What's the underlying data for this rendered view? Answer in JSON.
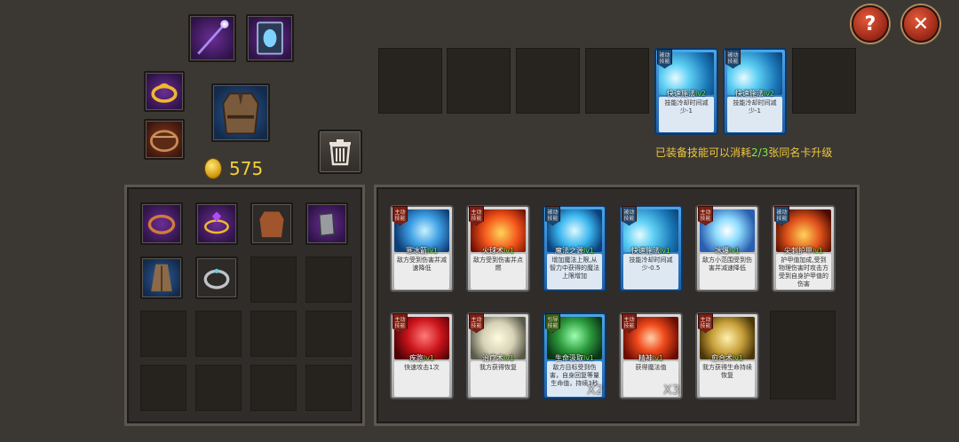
{
  "gold": {
    "amount": "575"
  },
  "buttons": {
    "help": "?",
    "close": "✕"
  },
  "upgrade_note": {
    "prefix": "已装备技能可以消耗",
    "ratio": "2/3",
    "suffix": "张同名卡升级"
  },
  "equipped_skills": [
    {
      "tag": "被动技能",
      "name": "快速施法",
      "level": "lv2",
      "desc": "技能冷却时间减少-1",
      "art": "wave"
    },
    {
      "tag": "被动技能",
      "name": "快速施法",
      "level": "lv2",
      "desc": "技能冷却时间减少-1",
      "art": "wave"
    }
  ],
  "skill_cards": [
    {
      "tag": "主动技能",
      "name": "寒冰箭",
      "level": "lv1",
      "desc": "敌方受到伤害并减速降低",
      "art": "ice",
      "frame": "silver",
      "tagc": "red"
    },
    {
      "tag": "主动技能",
      "name": "火球术",
      "level": "lv1",
      "desc": "敌方受到伤害并点燃",
      "art": "fire",
      "frame": "silver",
      "tagc": "red"
    },
    {
      "tag": "被动技能",
      "name": "魔法之源",
      "level": "lv1",
      "desc": "增加魔法上限,从智力中获得的魔法上限增加",
      "art": "orb",
      "frame": "blue",
      "tagc": "blue"
    },
    {
      "tag": "被动技能",
      "name": "快速施法",
      "level": "lv1",
      "desc": "技能冷却时间减少-0.5",
      "art": "wave",
      "frame": "blue",
      "tagc": "blue"
    },
    {
      "tag": "主动技能",
      "name": "冰爆",
      "level": "lv1",
      "desc": "敌方小范围受到伤害并减速降低",
      "art": "burst",
      "frame": "silver",
      "tagc": "red"
    },
    {
      "tag": "被动技能",
      "name": "尖刺护甲",
      "level": "lv1",
      "desc": "护甲值加成,受到物理伤害时攻击方受到自身护甲值的伤害",
      "art": "spikes",
      "frame": "silver",
      "tagc": "blue"
    },
    {
      "tag": "主动技能",
      "name": "疾跑",
      "level": "lv1",
      "desc": "快速攻击1次",
      "art": "slash",
      "frame": "silver",
      "tagc": "red"
    },
    {
      "tag": "主动技能",
      "name": "治疗术",
      "level": "lv1",
      "desc": "我方获得恢复",
      "art": "hand",
      "frame": "silver",
      "tagc": "red"
    },
    {
      "tag": "引导技能",
      "name": "生命汲取",
      "level": "lv1",
      "desc": "敌方目标受到伤害，自身回复等量生命值，持续3秒",
      "art": "ghost",
      "frame": "blue",
      "tagc": "green",
      "count": "X2"
    },
    {
      "tag": "主动技能",
      "name": "精神",
      "level": "lv1",
      "desc": "获得魔法值",
      "art": "swirl",
      "frame": "silver",
      "tagc": "red",
      "count": "X3"
    },
    {
      "tag": "主动技能",
      "name": "愈合术",
      "level": "lv1",
      "desc": "我方获得生命持续恢复",
      "art": "gold",
      "frame": "silver",
      "tagc": "red"
    }
  ]
}
